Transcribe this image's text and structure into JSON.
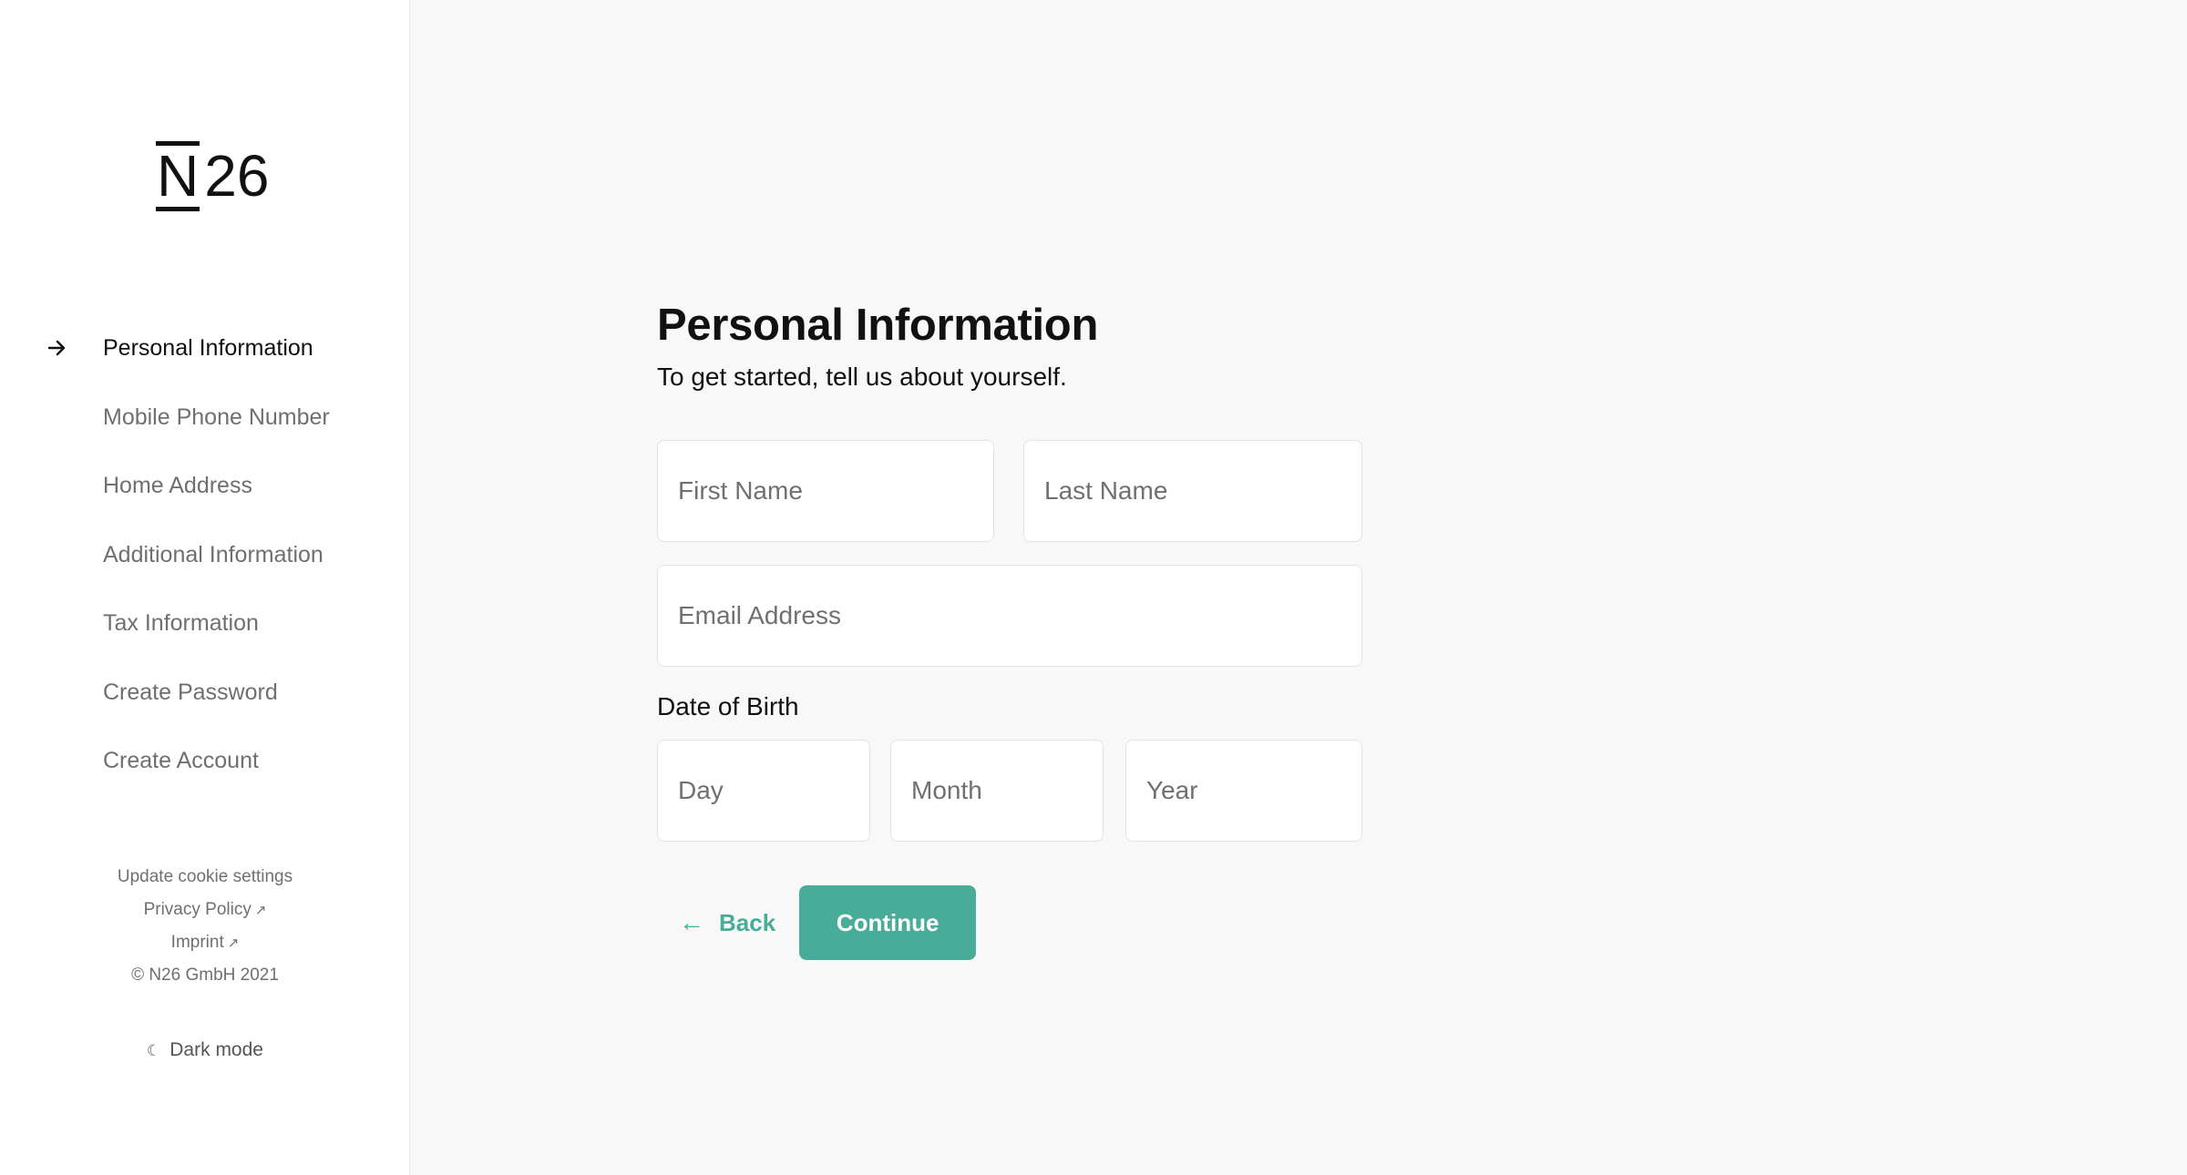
{
  "brand": {
    "logo_letter": "N",
    "logo_number": "26"
  },
  "sidebar": {
    "steps": [
      {
        "label": "Personal Information",
        "active": true
      },
      {
        "label": "Mobile Phone Number",
        "active": false
      },
      {
        "label": "Home Address",
        "active": false
      },
      {
        "label": "Additional Information",
        "active": false
      },
      {
        "label": "Tax Information",
        "active": false
      },
      {
        "label": "Create Password",
        "active": false
      },
      {
        "label": "Create Account",
        "active": false
      }
    ],
    "current_step_icon": "arrow-right-icon",
    "footer": {
      "cookie_settings": "Update cookie settings",
      "privacy_policy": "Privacy Policy",
      "imprint": "Imprint",
      "external_icon": "↗",
      "copyright": "© N26 GmbH 2021"
    },
    "dark_mode": {
      "icon": "☾",
      "label": "Dark mode"
    }
  },
  "form": {
    "title": "Personal Information",
    "subtitle": "To get started, tell us about yourself.",
    "first_name": {
      "value": "",
      "placeholder": "First Name"
    },
    "last_name": {
      "value": "",
      "placeholder": "Last Name"
    },
    "email": {
      "value": "",
      "placeholder": "Email Address"
    },
    "dob": {
      "label": "Date of Birth",
      "day": {
        "value": "",
        "placeholder": "Day"
      },
      "month": {
        "value": "",
        "placeholder": "Month"
      },
      "year": {
        "value": "",
        "placeholder": "Year"
      }
    },
    "back_arrow": "←",
    "back_label": "Back",
    "continue_label": "Continue"
  },
  "colors": {
    "accent": "#48ac98",
    "sidebar_bg": "#ffffff",
    "main_bg": "#f8f8f8",
    "text_primary": "#111111",
    "text_muted": "#6f6f6f"
  }
}
